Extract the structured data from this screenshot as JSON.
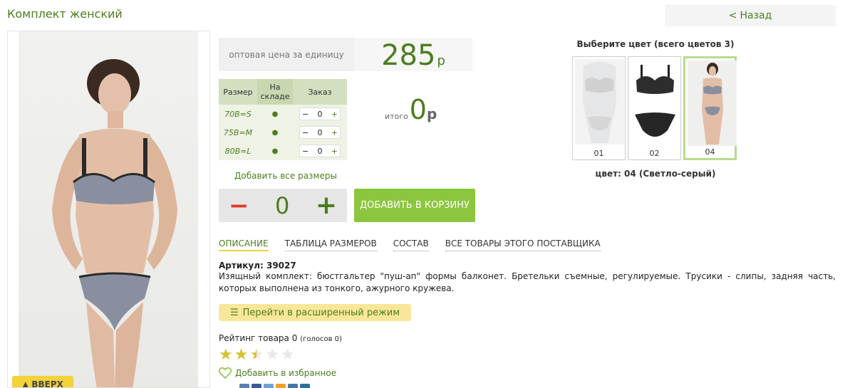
{
  "header": {
    "title": "Комплект женский",
    "back_label": "Назад"
  },
  "product": {
    "up_label": "ВВЕРХ",
    "price_label": "оптовая цена за единицу",
    "price": "285",
    "currency": "р"
  },
  "sizes": {
    "headers": [
      "Размер",
      "На складе",
      "Заказ"
    ],
    "rows": [
      {
        "size": "70B=S",
        "in_stock": "●",
        "qty": "0"
      },
      {
        "size": "75B=M",
        "in_stock": "●",
        "qty": "0"
      },
      {
        "size": "80B=L",
        "in_stock": "●",
        "qty": "0"
      }
    ],
    "minus": "−",
    "plus": "+"
  },
  "total": {
    "label": "итого",
    "value": "0",
    "currency": "р"
  },
  "add_all_sizes": "Добавить все размеры",
  "quantity": {
    "minus": "−",
    "value": "0",
    "plus": "+"
  },
  "cart_button": "ДОБАВИТЬ В КОРЗИНУ",
  "colors": {
    "title": "Выберите цвет (всего цветов 3)",
    "swatches": [
      {
        "num": "01",
        "selected": false
      },
      {
        "num": "02",
        "selected": false
      },
      {
        "num": "04",
        "selected": true
      }
    ],
    "selected_label": "цвет: 04 (Светло-серый)"
  },
  "tabs": [
    {
      "label": "ОПИСАНИЕ",
      "active": true
    },
    {
      "label": "ТАБЛИЦА РАЗМЕРОВ",
      "active": false
    },
    {
      "label": "СОСТАВ",
      "active": false
    },
    {
      "label": "ВСЕ ТОВАРЫ ЭТОГО ПОСТАВЩИКА",
      "active": false
    }
  ],
  "article": "Артикул: 39027",
  "description": "Изящный комплект: бюстгальтер \"пуш-ап\" формы балконет. Бретельки съемные, регулируемые. Трусики - слипы, задняя часть, которых выполнена из тонкого, ажурного кружева.",
  "advanced_mode": "Перейти в расширенный режим",
  "rating": {
    "label": "Рейтинг товара",
    "value": "0",
    "votes": "(голосов 0)",
    "stars_filled": 2.5,
    "stars_total": 5
  },
  "favorite": "Добавить в избранное",
  "colors_theme": {
    "accent": "#4d7d1f",
    "button_green": "#8cc63e",
    "minus_red": "#e03a2a",
    "yellow": "#f3d23a"
  }
}
